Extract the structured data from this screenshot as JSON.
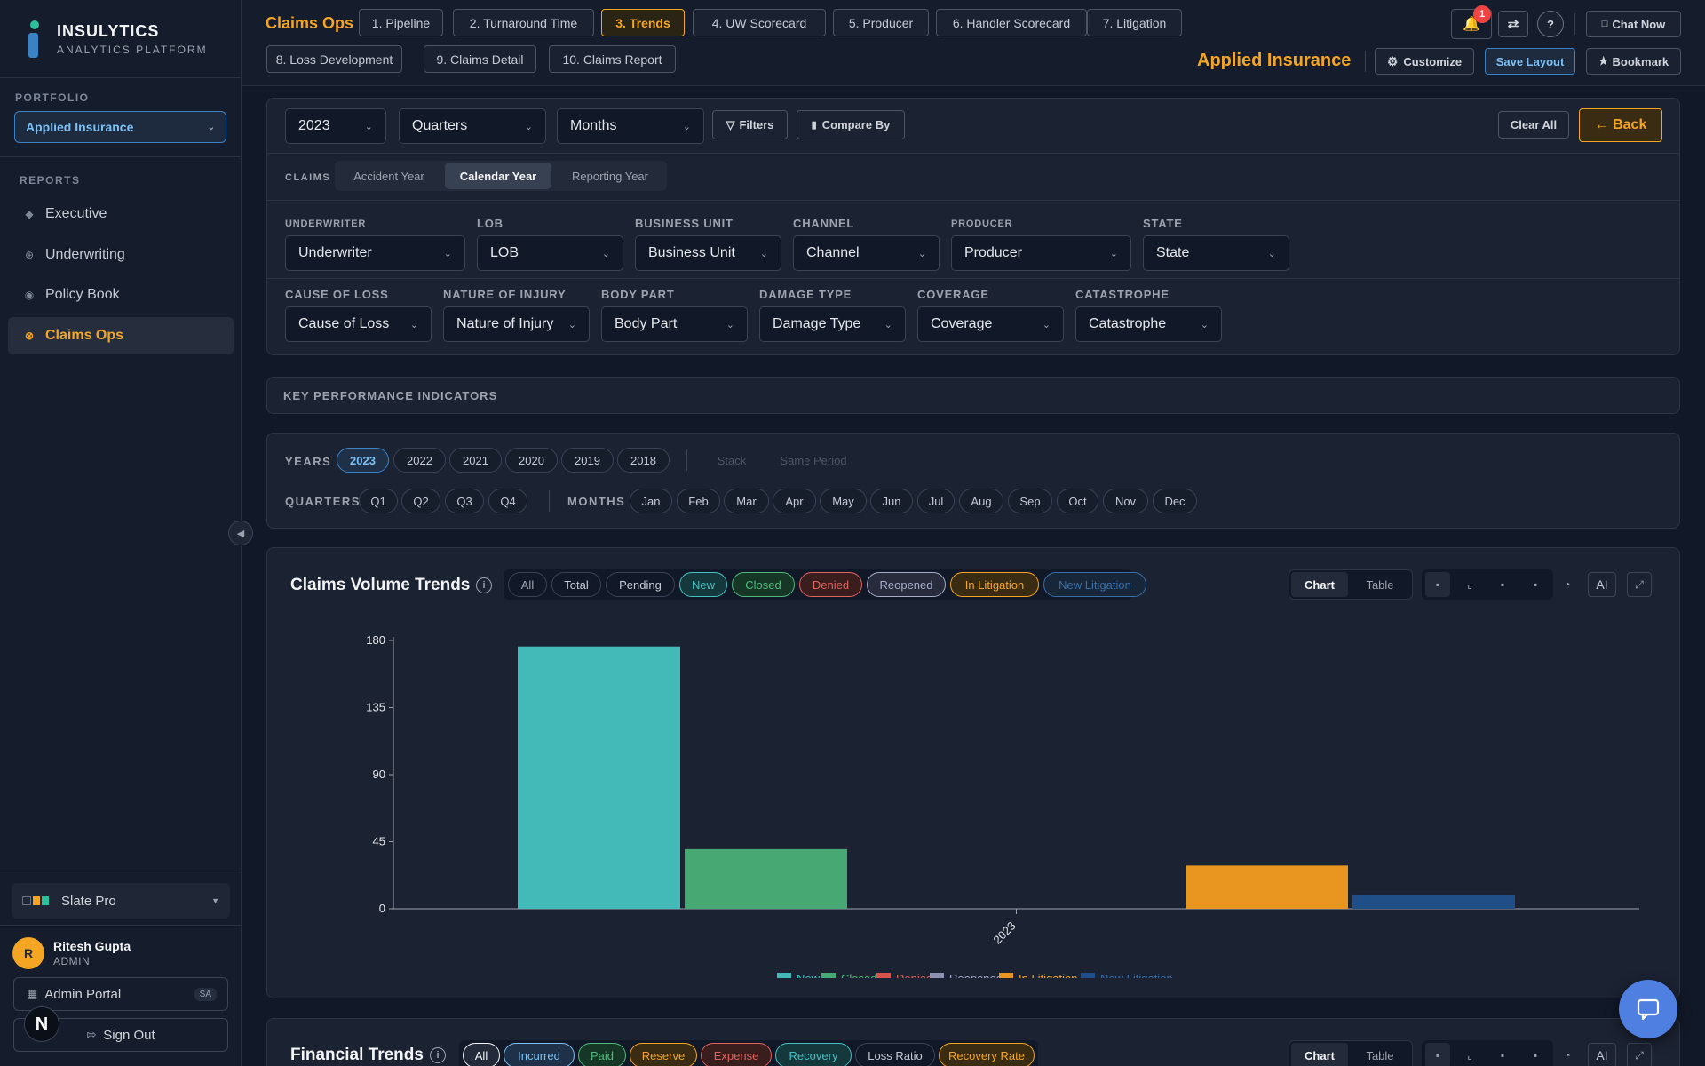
{
  "brand": {
    "title": "INSULYTICS",
    "subtitle": "ANALYTICS PLATFORM"
  },
  "sidebar": {
    "portfolio_label": "PORTFOLIO",
    "portfolio_value": "Applied Insurance",
    "reports_label": "REPORTS",
    "items": [
      {
        "label": "Executive",
        "icon": "diamond-icon"
      },
      {
        "label": "Underwriting",
        "icon": "target-icon"
      },
      {
        "label": "Policy Book",
        "icon": "circle-icon"
      },
      {
        "label": "Claims Ops",
        "icon": "target-icon",
        "active": true
      }
    ],
    "theme": "Slate Pro",
    "user": {
      "initial": "R",
      "name": "Ritesh Gupta",
      "role": "ADMIN"
    },
    "admin_portal": "Admin Portal",
    "admin_badge": "SA",
    "sign_out": "Sign Out",
    "n_badge": "N"
  },
  "header": {
    "page_title": "Claims Ops",
    "tabs": [
      "1. Pipeline",
      "2. Turnaround Time",
      "3. Trends",
      "4. UW Scorecard",
      "5. Producer",
      "6. Handler Scorecard",
      "7. Litigation",
      "8. Loss Development",
      "9. Claims Detail",
      "10. Claims Report"
    ],
    "active_tab": "3. Trends",
    "notification_count": "1",
    "chat_now": "Chat Now",
    "company": "Applied Insurance",
    "customize": "Customize",
    "save_layout": "Save Layout",
    "bookmark": "Bookmark"
  },
  "filters": {
    "year": "2023",
    "quarters": "Quarters",
    "months": "Months",
    "filters_btn": "Filters",
    "compare_by": "Compare By",
    "clear_all": "Clear All",
    "back": "← Back",
    "claims_label": "CLAIMS",
    "claim_modes": [
      "Accident Year",
      "Calendar Year",
      "Reporting Year"
    ],
    "active_mode": "Calendar Year",
    "row1": [
      {
        "label": "UNDERWRITER",
        "value": "Underwriter"
      },
      {
        "label": "LOB",
        "value": "LOB"
      },
      {
        "label": "BUSINESS UNIT",
        "value": "Business Unit"
      },
      {
        "label": "CHANNEL",
        "value": "Channel"
      },
      {
        "label": "PRODUCER",
        "value": "Producer"
      },
      {
        "label": "STATE",
        "value": "State"
      }
    ],
    "row2": [
      {
        "label": "CAUSE OF LOSS",
        "value": "Cause of Loss"
      },
      {
        "label": "NATURE OF INJURY",
        "value": "Nature of Injury"
      },
      {
        "label": "BODY PART",
        "value": "Body Part"
      },
      {
        "label": "DAMAGE TYPE",
        "value": "Damage Type"
      },
      {
        "label": "COVERAGE",
        "value": "Coverage"
      },
      {
        "label": "CATASTROPHE",
        "value": "Catastrophe"
      }
    ]
  },
  "kpi": {
    "title": "KEY PERFORMANCE INDICATORS"
  },
  "period": {
    "years_label": "YEARS",
    "years": [
      "2023",
      "2022",
      "2021",
      "2020",
      "2019",
      "2018"
    ],
    "active_year": "2023",
    "stack": "Stack",
    "same_period": "Same Period",
    "quarters_label": "QUARTERS",
    "quarters": [
      "Q1",
      "Q2",
      "Q3",
      "Q4"
    ],
    "months_label": "MONTHS",
    "months": [
      "Jan",
      "Feb",
      "Mar",
      "Apr",
      "May",
      "Jun",
      "Jul",
      "Aug",
      "Sep",
      "Oct",
      "Nov",
      "Dec"
    ]
  },
  "volume_chart": {
    "title": "Claims Volume Trends",
    "filters": [
      {
        "label": "All",
        "color": "#9ca3af",
        "bg": "transparent"
      },
      {
        "label": "Total",
        "color": "#c5cbd6",
        "bg": "transparent"
      },
      {
        "label": "Pending",
        "color": "#c5cbd6",
        "bg": "transparent"
      },
      {
        "label": "New",
        "color": "#45c1c1",
        "bg": "#15383d"
      },
      {
        "label": "Closed",
        "color": "#4fb97c",
        "bg": "#163726"
      },
      {
        "label": "Denied",
        "color": "#e0625e",
        "bg": "#3a1e1e"
      },
      {
        "label": "Reopened",
        "color": "#a7acc8",
        "bg": "#272b3b"
      },
      {
        "label": "In Litigation",
        "color": "#f5a524",
        "bg": "#3a2c12"
      },
      {
        "label": "New Litigation",
        "color": "#3a6ea8",
        "bg": "#172639"
      }
    ],
    "view_chart": "Chart",
    "view_table": "Table",
    "ai": "AI"
  },
  "chart_data": {
    "type": "bar",
    "categories": [
      "2023"
    ],
    "series": [
      {
        "name": "New",
        "values": [
          176
        ],
        "color": "#43b9b8"
      },
      {
        "name": "Closed",
        "values": [
          40
        ],
        "color": "#48a874"
      },
      {
        "name": "Denied",
        "values": [
          0
        ],
        "color": "#d6534f"
      },
      {
        "name": "Reopened",
        "values": [
          0
        ],
        "color": "#8b91b0"
      },
      {
        "name": "In Litigation",
        "values": [
          29
        ],
        "color": "#e8961f"
      },
      {
        "name": "New Litigation",
        "values": [
          9
        ],
        "color": "#1f4f86"
      }
    ],
    "legend_label_colors": [
      "#45c1c1",
      "#4fb97c",
      "#e0625e",
      "#a7acc8",
      "#f5a524",
      "#3a6ea8"
    ],
    "yticks": [
      0,
      45,
      90,
      135,
      180
    ],
    "ylim": [
      0,
      180
    ],
    "title": "Claims Volume Trends",
    "legend": "bottom",
    "grid": false
  },
  "financial_chart": {
    "title": "Financial Trends",
    "filters": [
      {
        "label": "All",
        "color": "#f3f4f6",
        "bg": "#232b3b"
      },
      {
        "label": "Incurred",
        "color": "#7cc0f5",
        "bg": "#1e3148"
      },
      {
        "label": "Paid",
        "color": "#4fb97c",
        "bg": "#163726"
      },
      {
        "label": "Reserve",
        "color": "#f5a524",
        "bg": "#3a2c12"
      },
      {
        "label": "Expense",
        "color": "#e0625e",
        "bg": "#3a1e1e"
      },
      {
        "label": "Recovery",
        "color": "#45c1c1",
        "bg": "#15383d"
      },
      {
        "label": "Loss Ratio",
        "color": "#c5cbd6",
        "bg": "transparent"
      },
      {
        "label": "Recovery Rate",
        "color": "#f5a524",
        "bg": "#3a2c12"
      }
    ],
    "view_chart": "Chart",
    "view_table": "Table",
    "ai": "AI"
  }
}
